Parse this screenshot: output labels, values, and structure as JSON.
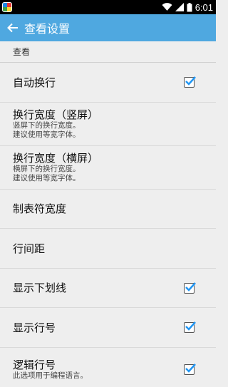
{
  "statusbar": {
    "time": "6:01"
  },
  "appbar": {
    "title": "查看设置"
  },
  "section": {
    "header": "查看"
  },
  "prefs": [
    {
      "title": "自动换行",
      "summary": "",
      "checked": true
    },
    {
      "title": "换行宽度（竖屏）",
      "summary": "竖屏下的换行宽度。\n建议使用等宽字体。",
      "checked": false
    },
    {
      "title": "换行宽度（横屏）",
      "summary": "横屏下的换行宽度。\n建议使用等宽字体。",
      "checked": false
    },
    {
      "title": "制表符宽度",
      "summary": "",
      "checked": false
    },
    {
      "title": "行间距",
      "summary": "",
      "checked": false
    },
    {
      "title": "显示下划线",
      "summary": "",
      "checked": true
    },
    {
      "title": "显示行号",
      "summary": "",
      "checked": true
    },
    {
      "title": "逻辑行号",
      "summary": "此选项用于编程语言。",
      "checked": true
    }
  ],
  "summaries": {
    "portrait_line1": "竖屏下的换行宽度。",
    "portrait_line2": "建议使用等宽字体。",
    "landscape_line1": "横屏下的换行宽度。",
    "landscape_line2": "建议使用等宽字体。"
  },
  "colors": {
    "appbar": "#4fa8e0",
    "check": "#2196f3"
  }
}
